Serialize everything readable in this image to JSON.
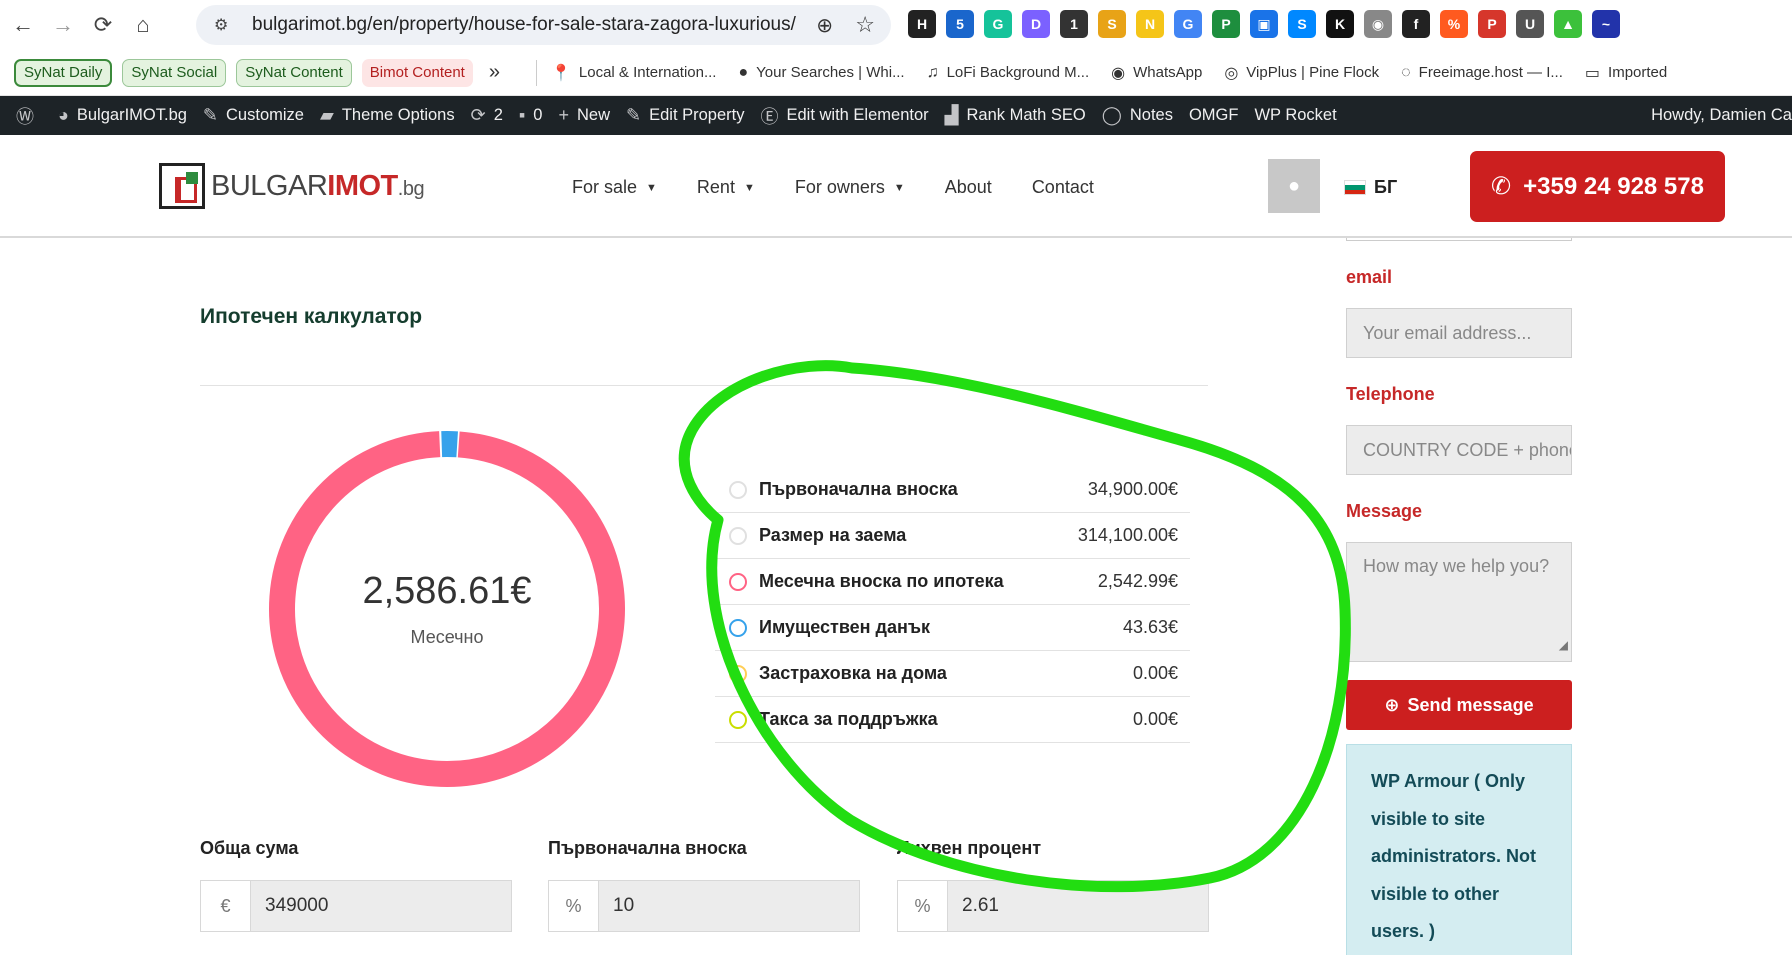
{
  "browser": {
    "url": "bulgarimot.bg/en/property/house-for-sale-stara-zagora-luxurious/",
    "extensions": [
      {
        "icon": "hashnode-icon",
        "color": "#222222",
        "glyph": "H"
      },
      {
        "icon": "buffer-icon",
        "color": "#1a66cc",
        "glyph": "5"
      },
      {
        "icon": "grammarly-icon",
        "color": "#15c39a",
        "glyph": "G"
      },
      {
        "icon": "dot-icon",
        "color": "#7b61ff",
        "glyph": "D"
      },
      {
        "icon": "monitor-icon",
        "color": "#333333",
        "glyph": "1"
      },
      {
        "icon": "seo-icon",
        "color": "#e8a317",
        "glyph": "S"
      },
      {
        "icon": "notes-icon",
        "color": "#f5c518",
        "glyph": "N"
      },
      {
        "icon": "translate-icon",
        "color": "#4285f4",
        "glyph": "G"
      },
      {
        "icon": "pause-icon",
        "color": "#1e8e3e",
        "glyph": "P"
      },
      {
        "icon": "screen-icon",
        "color": "#1a73e8",
        "glyph": "▣"
      },
      {
        "icon": "shazam-icon",
        "color": "#0088ff",
        "glyph": "S"
      },
      {
        "icon": "k-icon",
        "color": "#111111",
        "glyph": "K"
      },
      {
        "icon": "camera-icon",
        "color": "#888888",
        "glyph": "◉"
      },
      {
        "icon": "font-icon",
        "color": "#222222",
        "glyph": "f"
      },
      {
        "icon": "color-icon",
        "color": "#ff5a1f",
        "glyph": "%"
      },
      {
        "icon": "pick-icon",
        "color": "#d6362b",
        "glyph": "P"
      },
      {
        "icon": "ublock-icon",
        "color": "#555555",
        "glyph": "U"
      },
      {
        "icon": "thumb-icon",
        "color": "#3cc13b",
        "glyph": "▲"
      },
      {
        "icon": "analytics-icon",
        "color": "#2233aa",
        "glyph": "~"
      }
    ]
  },
  "bookmarks": {
    "pills": [
      {
        "label": "SyNat Daily",
        "style": "green-outlined"
      },
      {
        "label": "SyNat Social",
        "style": "green"
      },
      {
        "label": "SyNat Content",
        "style": "green"
      },
      {
        "label": "Bimot Content",
        "style": "red"
      }
    ],
    "more": "»",
    "items": [
      {
        "label": "Local & Internation...",
        "icon": "map-pin-icon",
        "glyph": "📍"
      },
      {
        "label": "Your Searches | Whi...",
        "icon": "circle-icon",
        "glyph": "●"
      },
      {
        "label": "LoFi Background M...",
        "icon": "music-icon",
        "glyph": "♫"
      },
      {
        "label": "WhatsApp",
        "icon": "whatsapp-icon",
        "glyph": "◉"
      },
      {
        "label": "VipPlus | Pine Flock",
        "icon": "pf-icon",
        "glyph": "◎"
      },
      {
        "label": "Freeimage.host — I...",
        "icon": "image-icon",
        "glyph": "◌"
      },
      {
        "label": "Imported",
        "icon": "folder-icon",
        "glyph": "▭"
      }
    ]
  },
  "wpbar": {
    "items": [
      {
        "label": "",
        "icon": "wordpress-icon",
        "glyph": "Ⓦ"
      },
      {
        "label": "BulgarIMOT.bg",
        "icon": "dashboard-icon",
        "glyph": "◕"
      },
      {
        "label": "Customize",
        "icon": "brush-icon",
        "glyph": "✎"
      },
      {
        "label": "Theme Options",
        "icon": "folder-icon",
        "glyph": "▰"
      },
      {
        "label": "2",
        "icon": "updates-icon",
        "glyph": "⟳"
      },
      {
        "label": "0",
        "icon": "comments-icon",
        "glyph": "▪"
      },
      {
        "label": "New",
        "icon": "plus-icon",
        "glyph": "+"
      },
      {
        "label": "Edit Property",
        "icon": "pencil-icon",
        "glyph": "✎"
      },
      {
        "label": "Edit with Elementor",
        "icon": "elementor-icon",
        "glyph": "Ⓔ"
      },
      {
        "label": "Rank Math SEO",
        "icon": "rankmath-icon",
        "glyph": "▟"
      },
      {
        "label": "Notes",
        "icon": "notes-icon",
        "glyph": "◯"
      },
      {
        "label": "OMGF",
        "icon": "",
        "glyph": ""
      },
      {
        "label": "WP Rocket",
        "icon": "",
        "glyph": ""
      }
    ],
    "howdy": "Howdy, Damien Ca"
  },
  "header": {
    "logo": {
      "part1": "BULGAR",
      "part2": "IMOT",
      "part3": ".bg"
    },
    "menu": [
      {
        "label": "For sale",
        "dropdown": true
      },
      {
        "label": "Rent",
        "dropdown": true
      },
      {
        "label": "For owners",
        "dropdown": true
      },
      {
        "label": "About",
        "dropdown": false
      },
      {
        "label": "Contact",
        "dropdown": false
      }
    ],
    "lang": "БГ",
    "phone": "+359 24 928 578"
  },
  "calculator": {
    "title": "Ипотечен калкулатор",
    "total": "2,586.61€",
    "period": "Месечно",
    "breakdown": [
      {
        "label": "Първоначална вноска",
        "value": "34,900.00€",
        "color": "#e0e0e0"
      },
      {
        "label": "Размер на заема",
        "value": "314,100.00€",
        "color": "#e0e0e0"
      },
      {
        "label": "Месечна вноска по ипотека",
        "value": "2,542.99€",
        "color": "#ff6384"
      },
      {
        "label": "Имуществен данък",
        "value": "43.63€",
        "color": "#36a2eb"
      },
      {
        "label": "Застраховка на дома",
        "value": "0.00€",
        "color": "#ffce56"
      },
      {
        "label": "Такса за поддръжка",
        "value": "0.00€",
        "color": "#c9de00"
      }
    ],
    "donut": {
      "mortgage": 2542.99,
      "tax": 43.63,
      "insurance": 0.0,
      "maintenance": 0.0
    },
    "fields": [
      {
        "label": "Обща сума",
        "prefix": "€",
        "value": "349000"
      },
      {
        "label": "Първоначална вноска",
        "prefix": "%",
        "value": "10"
      },
      {
        "label": "Лихвен процент",
        "prefix": "%",
        "value": "2.61"
      }
    ]
  },
  "form": {
    "email_label": "email",
    "email_placeholder": "Your email address...",
    "phone_label": "Telephone",
    "phone_placeholder": "COUNTRY CODE + phone",
    "message_label": "Message",
    "message_placeholder": "How may we help you?",
    "send_label": "Send message",
    "notice": "WP Armour ( Only visible to site administrators. Not visible to other users. )"
  },
  "colors": {
    "brand_red": "#cc1f1f",
    "annotation": "#22dd11",
    "donut_mortgage": "#ff6384",
    "donut_tax": "#36a2eb"
  }
}
